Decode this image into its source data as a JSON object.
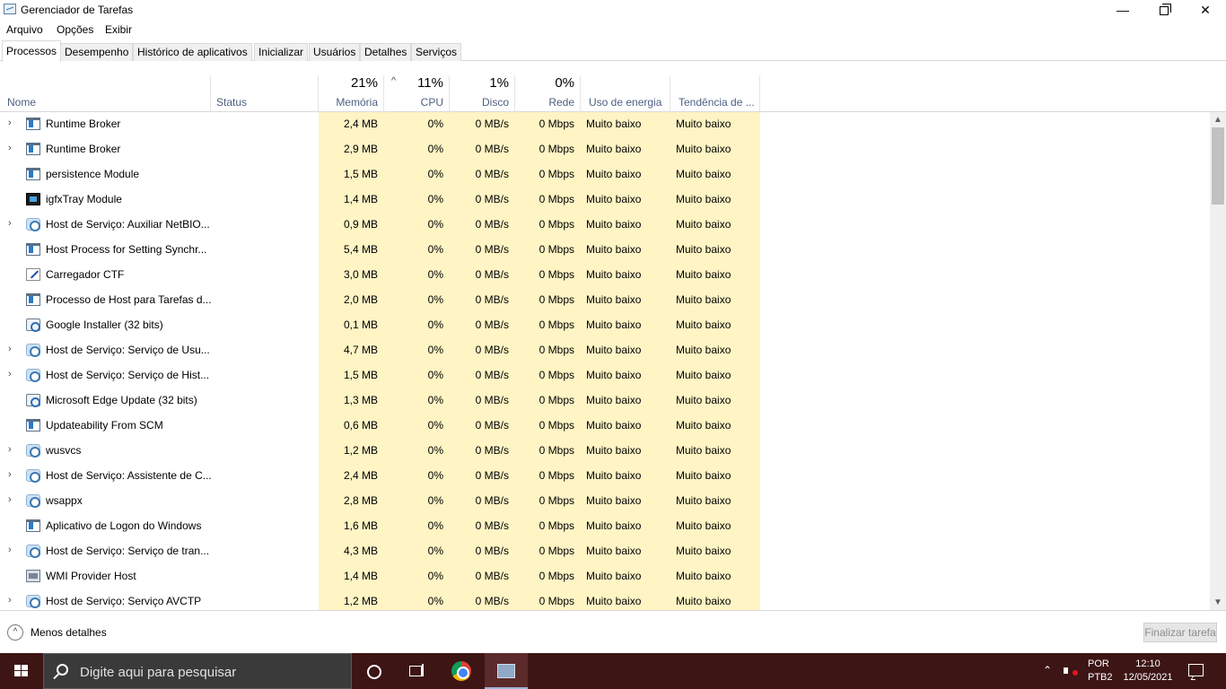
{
  "window": {
    "title": "Gerenciador de Tarefas",
    "minimize_glyph": "—",
    "close_glyph": "✕"
  },
  "menu": [
    "Arquivo",
    "Opções",
    "Exibir"
  ],
  "tabs": [
    "Processos",
    "Desempenho",
    "Histórico de aplicativos",
    "Inicializar",
    "Usuários",
    "Detalhes",
    "Serviços"
  ],
  "active_tab": "Processos",
  "header": {
    "name": "Nome",
    "status": "Status",
    "memory_pct": "21%",
    "memory": "Memória",
    "cpu_pct": "11%",
    "cpu": "CPU",
    "disk_pct": "1%",
    "disk": "Disco",
    "network_pct": "0%",
    "network": "Rede",
    "energy": "Uso de energia",
    "energy_trend": "Tendência de ..."
  },
  "colors": {
    "highlight_column": "#fff4c4",
    "header_label": "#4d6082",
    "taskbar": "#3d1515"
  },
  "processes": [
    {
      "expand": true,
      "icon": "window-icon",
      "name": "Runtime Broker",
      "memory": "2,4 MB",
      "cpu": "0%",
      "disk": "0 MB/s",
      "network": "0 Mbps",
      "energy": "Muito baixo",
      "trend": "Muito baixo"
    },
    {
      "expand": true,
      "icon": "window-icon",
      "name": "Runtime Broker",
      "memory": "2,9 MB",
      "cpu": "0%",
      "disk": "0 MB/s",
      "network": "0 Mbps",
      "energy": "Muito baixo",
      "trend": "Muito baixo"
    },
    {
      "expand": false,
      "icon": "window-icon",
      "name": "persistence Module",
      "memory": "1,5 MB",
      "cpu": "0%",
      "disk": "0 MB/s",
      "network": "0 Mbps",
      "energy": "Muito baixo",
      "trend": "Muito baixo"
    },
    {
      "expand": false,
      "icon": "igfx-icon",
      "name": "igfxTray Module",
      "memory": "1,4 MB",
      "cpu": "0%",
      "disk": "0 MB/s",
      "network": "0 Mbps",
      "energy": "Muito baixo",
      "trend": "Muito baixo"
    },
    {
      "expand": true,
      "icon": "gear-icon",
      "name": "Host de Serviço: Auxiliar NetBIO...",
      "memory": "0,9 MB",
      "cpu": "0%",
      "disk": "0 MB/s",
      "network": "0 Mbps",
      "energy": "Muito baixo",
      "trend": "Muito baixo"
    },
    {
      "expand": false,
      "icon": "window-icon",
      "name": "Host Process for Setting Synchr...",
      "memory": "5,4 MB",
      "cpu": "0%",
      "disk": "0 MB/s",
      "network": "0 Mbps",
      "energy": "Muito baixo",
      "trend": "Muito baixo"
    },
    {
      "expand": false,
      "icon": "pen-icon",
      "name": "Carregador CTF",
      "memory": "3,0 MB",
      "cpu": "0%",
      "disk": "0 MB/s",
      "network": "0 Mbps",
      "energy": "Muito baixo",
      "trend": "Muito baixo"
    },
    {
      "expand": false,
      "icon": "window-icon",
      "name": "Processo de Host para Tarefas d...",
      "memory": "2,0 MB",
      "cpu": "0%",
      "disk": "0 MB/s",
      "network": "0 Mbps",
      "energy": "Muito baixo",
      "trend": "Muito baixo"
    },
    {
      "expand": false,
      "icon": "installer-icon",
      "name": "Google Installer (32 bits)",
      "memory": "0,1 MB",
      "cpu": "0%",
      "disk": "0 MB/s",
      "network": "0 Mbps",
      "energy": "Muito baixo",
      "trend": "Muito baixo"
    },
    {
      "expand": true,
      "icon": "gear-icon",
      "name": "Host de Serviço: Serviço de Usu...",
      "memory": "4,7 MB",
      "cpu": "0%",
      "disk": "0 MB/s",
      "network": "0 Mbps",
      "energy": "Muito baixo",
      "trend": "Muito baixo"
    },
    {
      "expand": true,
      "icon": "gear-icon",
      "name": "Host de Serviço: Serviço de Hist...",
      "memory": "1,5 MB",
      "cpu": "0%",
      "disk": "0 MB/s",
      "network": "0 Mbps",
      "energy": "Muito baixo",
      "trend": "Muito baixo"
    },
    {
      "expand": false,
      "icon": "installer-icon",
      "name": "Microsoft Edge Update (32 bits)",
      "memory": "1,3 MB",
      "cpu": "0%",
      "disk": "0 MB/s",
      "network": "0 Mbps",
      "energy": "Muito baixo",
      "trend": "Muito baixo"
    },
    {
      "expand": false,
      "icon": "window-icon",
      "name": "Updateability From SCM",
      "memory": "0,6 MB",
      "cpu": "0%",
      "disk": "0 MB/s",
      "network": "0 Mbps",
      "energy": "Muito baixo",
      "trend": "Muito baixo"
    },
    {
      "expand": true,
      "icon": "gear-icon",
      "name": "wusvcs",
      "memory": "1,2 MB",
      "cpu": "0%",
      "disk": "0 MB/s",
      "network": "0 Mbps",
      "energy": "Muito baixo",
      "trend": "Muito baixo"
    },
    {
      "expand": true,
      "icon": "gear-icon",
      "name": "Host de Serviço: Assistente de C...",
      "memory": "2,4 MB",
      "cpu": "0%",
      "disk": "0 MB/s",
      "network": "0 Mbps",
      "energy": "Muito baixo",
      "trend": "Muito baixo"
    },
    {
      "expand": true,
      "icon": "gear-icon",
      "name": "wsappx",
      "memory": "2,8 MB",
      "cpu": "0%",
      "disk": "0 MB/s",
      "network": "0 Mbps",
      "energy": "Muito baixo",
      "trend": "Muito baixo"
    },
    {
      "expand": false,
      "icon": "window-icon",
      "name": "Aplicativo de Logon do Windows",
      "memory": "1,6 MB",
      "cpu": "0%",
      "disk": "0 MB/s",
      "network": "0 Mbps",
      "energy": "Muito baixo",
      "trend": "Muito baixo"
    },
    {
      "expand": true,
      "icon": "gear-icon",
      "name": "Host de Serviço: Serviço de tran...",
      "memory": "4,3 MB",
      "cpu": "0%",
      "disk": "0 MB/s",
      "network": "0 Mbps",
      "energy": "Muito baixo",
      "trend": "Muito baixo"
    },
    {
      "expand": false,
      "icon": "wmi-icon",
      "name": "WMI Provider Host",
      "memory": "1,4 MB",
      "cpu": "0%",
      "disk": "0 MB/s",
      "network": "0 Mbps",
      "energy": "Muito baixo",
      "trend": "Muito baixo"
    },
    {
      "expand": true,
      "icon": "gear-icon",
      "name": "Host de Serviço: Serviço AVCTP",
      "memory": "1,2 MB",
      "cpu": "0%",
      "disk": "0 MB/s",
      "network": "0 Mbps",
      "energy": "Muito baixo",
      "trend": "Muito baixo"
    }
  ],
  "footer": {
    "less_details": "Menos detalhes",
    "end_task": "Finalizar tarefa"
  },
  "taskbar": {
    "search_placeholder": "Digite aqui para pesquisar",
    "lang_1": "POR",
    "lang_2": "PTB2",
    "time": "12:10",
    "date": "12/05/2021"
  }
}
